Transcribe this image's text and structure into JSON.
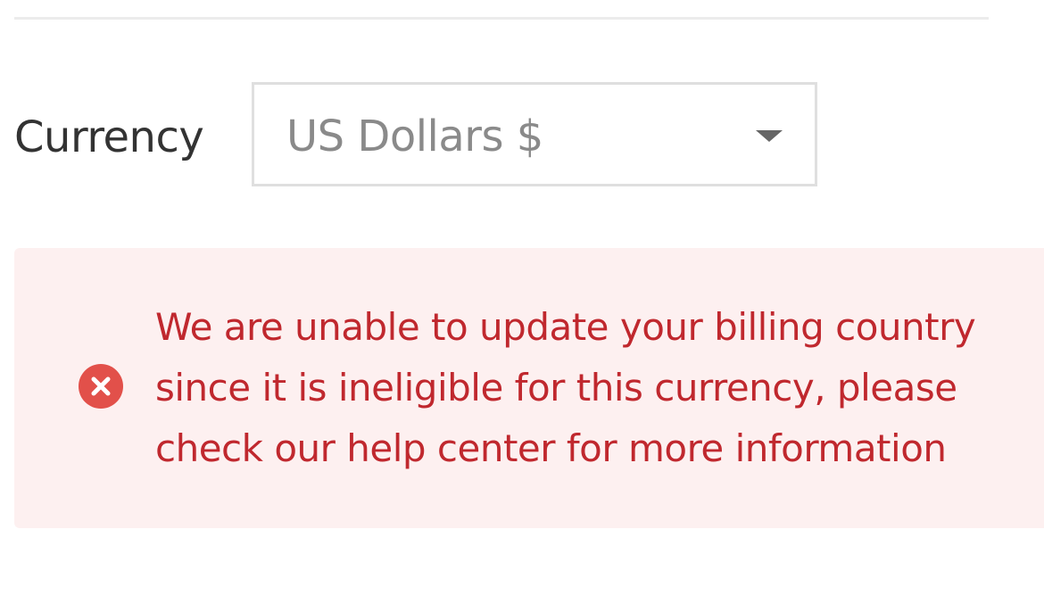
{
  "currency": {
    "label": "Currency",
    "selected_value": "US Dollars $"
  },
  "error": {
    "message": "We are unable to update your billing country since it is ineligible for this currency, please check our help center for more information"
  },
  "icons": {
    "select_caret": "chevron-down-icon",
    "error": "error-x-icon"
  },
  "colors": {
    "error_text": "#c0282e",
    "error_background": "#fdf0f0",
    "error_icon": "#e2504a",
    "label_text": "#333333",
    "select_text": "#8a8a8a",
    "select_border": "#dfdfdf"
  }
}
